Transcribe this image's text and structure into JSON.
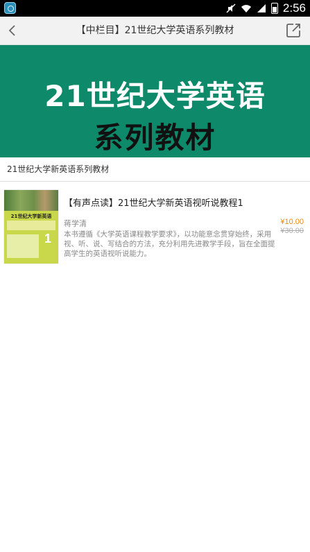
{
  "status_bar": {
    "time": "2:56"
  },
  "header": {
    "title": "【中栏目】21世纪大学英语系列教材"
  },
  "banner": {
    "line1": "21世纪大学英语",
    "line2": "系列教材"
  },
  "section": {
    "title": "21世纪大学新英语系列教材"
  },
  "book": {
    "title": "【有声点读】21世纪大学新英语视听说教程1",
    "author": "蒋学清",
    "price": "¥10.00",
    "original_price": "¥30.00",
    "description": "本书遵循《大学英语课程教学要求》，以功能意念贯穿始终，采用视、听、说、写结合的方法，充分利用先进教学手段，旨在全面提高学生的英语视听说能力。"
  }
}
